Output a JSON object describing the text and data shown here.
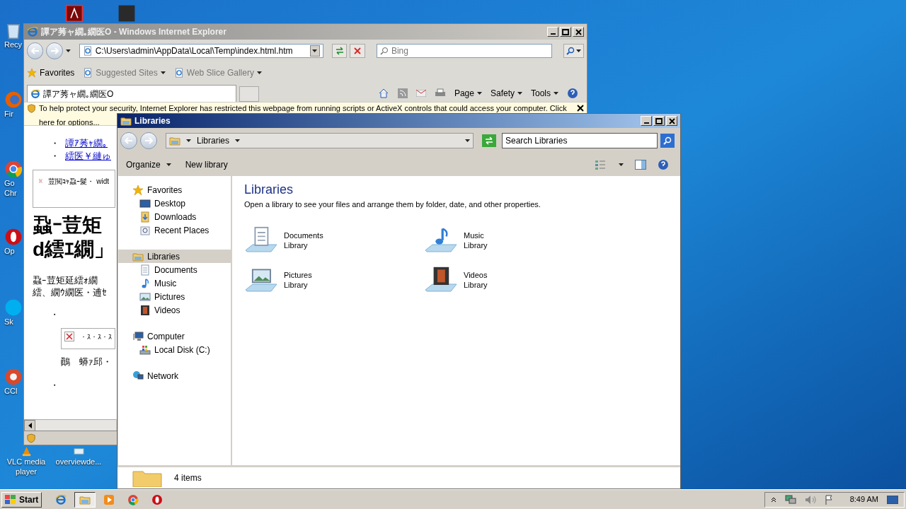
{
  "desktop": {
    "icons": [
      {
        "kind": "recycle",
        "lines": [
          "Recy"
        ]
      },
      {
        "kind": "pdf"
      },
      {
        "kind": "dark"
      },
      {
        "kind": "firefox",
        "lines": [
          "Fir"
        ]
      },
      {
        "kind": "chrome",
        "lines": [
          "Go",
          "Chr"
        ]
      },
      {
        "kind": "opera",
        "lines": [
          "Op"
        ]
      },
      {
        "kind": "skype",
        "lines": [
          "Sk"
        ]
      },
      {
        "kind": "ccleaner",
        "lines": [
          "CCl"
        ]
      },
      {
        "kind": "vlc",
        "lines": [
          "VLC media",
          "player"
        ]
      },
      {
        "kind": "file",
        "lines": [
          "overviewde..."
        ]
      }
    ]
  },
  "ie": {
    "title": "譚ア莠ャ繝｡繝医O - Windows Internet Explorer",
    "address": "C:\\Users\\admin\\AppData\\Local\\Temp\\index.html.htm",
    "search_placeholder": "Bing",
    "favorites": [
      {
        "kind": "star",
        "label": "Favorites"
      },
      {
        "kind": "page",
        "label": "Suggested Sites"
      },
      {
        "kind": "page",
        "label": "Web Slice Gallery"
      }
    ],
    "tab": "譚ア莠ャ繝｡繝医O",
    "commands": [
      "Page",
      "Safety",
      "Tools"
    ],
    "infobar": [
      "To help protect your security, Internet Explorer has restricted this webpage from running scripts or ActiveX controls that could access your computer. Click",
      "here for options..."
    ],
    "page": [
      {
        "kind": "link",
        "bullet": "・",
        "text": "譚ｱ莠ｬ繝｡"
      },
      {
        "kind": "link",
        "bullet": "・",
        "text": "繧医￥縺ゅ"
      },
      {
        "kind": "image",
        "text": "荳閲ｺｬ蝨ｰ髮・ widt"
      },
      {
        "kind": "heading",
        "text": "蝨ｰ荳矩"
      },
      {
        "kind": "heading",
        "text": "d繧ｴ繝」"
      },
      {
        "kind": "paragraph",
        "text": "蝨ｰ荳矩延繧ｫ繝"
      },
      {
        "kind": "paragraph",
        "text": "繧、繝ｳ繝医・逋ｾ"
      },
      {
        "kind": "bullet",
        "text": "・"
      },
      {
        "kind": "image",
        "text": "・ｽ・ｽ・ｽ"
      },
      {
        "kind": "caption",
        "text": "鷆　蟒ｧ邱・"
      },
      {
        "kind": "bullet",
        "text": "・"
      }
    ]
  },
  "explorer": {
    "title": "Libraries",
    "breadcrumb": "Libraries",
    "search_placeholder": "Search Libraries",
    "commands": [
      "Organize",
      "New library"
    ],
    "nav": [
      {
        "kind": "favorites",
        "label": "Favorites",
        "selected": false,
        "children": [
          {
            "kind": "desktop",
            "label": "Desktop",
            "selected": false
          },
          {
            "kind": "downloads",
            "label": "Downloads",
            "selected": false
          },
          {
            "kind": "recent",
            "label": "Recent Places",
            "selected": false
          }
        ]
      },
      {
        "kind": "libraries",
        "label": "Libraries",
        "selected": true,
        "children": [
          {
            "kind": "documents",
            "label": "Documents",
            "selected": false
          },
          {
            "kind": "music",
            "label": "Music",
            "selected": false
          },
          {
            "kind": "pictures",
            "label": "Pictures",
            "selected": false
          },
          {
            "kind": "videos",
            "label": "Videos",
            "selected": false
          }
        ]
      },
      {
        "kind": "computer",
        "label": "Computer",
        "selected": false,
        "children": [
          {
            "kind": "disk",
            "label": "Local Disk (C:)",
            "selected": false
          }
        ]
      },
      {
        "kind": "network",
        "label": "Network",
        "selected": false
      }
    ],
    "heading": "Libraries",
    "description": "Open a library to see your files and arrange them by folder, date, and other properties.",
    "items": [
      {
        "kind": "documents",
        "name": "Documents",
        "type": "Library"
      },
      {
        "kind": "music",
        "name": "Music",
        "type": "Library"
      },
      {
        "kind": "pictures",
        "name": "Pictures",
        "type": "Library"
      },
      {
        "kind": "videos",
        "name": "Videos",
        "type": "Library"
      }
    ],
    "status": "4 items"
  },
  "taskbar": {
    "start": "Start",
    "apps": [
      {
        "kind": "ie",
        "selected": false
      },
      {
        "kind": "explorer",
        "selected": true
      },
      {
        "kind": "media",
        "selected": false
      },
      {
        "kind": "chrome",
        "selected": false
      },
      {
        "kind": "opera",
        "selected": false
      }
    ],
    "clock": "8:49 AM"
  }
}
